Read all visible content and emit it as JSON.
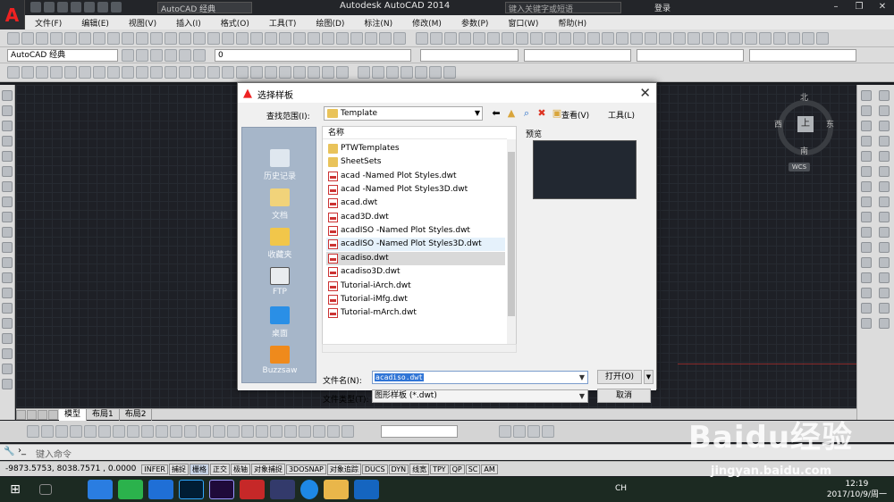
{
  "app": {
    "title": "Autodesk AutoCAD 2014",
    "workspace": "AutoCAD 经典",
    "search_placeholder": "键入关键字或短语",
    "login": "登录",
    "logo_letter": "A"
  },
  "menu": [
    "文件(F)",
    "编辑(E)",
    "视图(V)",
    "插入(I)",
    "格式(O)",
    "工具(T)",
    "绘图(D)",
    "标注(N)",
    "修改(M)",
    "参数(P)",
    "窗口(W)",
    "帮助(H)"
  ],
  "toolbar2": {
    "workspace": "AutoCAD 经典",
    "layer": "0"
  },
  "viewcube": {
    "top": "上",
    "north": "北",
    "south": "南",
    "east": "东",
    "west": "西",
    "wcs": "WCS"
  },
  "layout_tabs": [
    "模型",
    "布局1",
    "布局2"
  ],
  "command_line": {
    "placeholder": "键入命令"
  },
  "status": {
    "coords": "-9873.5753, 8038.7571 , 0.0000",
    "buttons": [
      {
        "label": "INFER",
        "on": false
      },
      {
        "label": "捕捉",
        "on": false
      },
      {
        "label": "栅格",
        "on": true
      },
      {
        "label": "正交",
        "on": false
      },
      {
        "label": "极轴",
        "on": false
      },
      {
        "label": "对象捕捉",
        "on": false
      },
      {
        "label": "3DOSNAP",
        "on": false
      },
      {
        "label": "对象追踪",
        "on": false
      },
      {
        "label": "DUCS",
        "on": false
      },
      {
        "label": "DYN",
        "on": false
      },
      {
        "label": "线宽",
        "on": false
      },
      {
        "label": "TPY",
        "on": false
      },
      {
        "label": "QP",
        "on": false
      },
      {
        "label": "SC",
        "on": false
      },
      {
        "label": "AM",
        "on": false
      }
    ]
  },
  "dialog": {
    "title": "选择样板",
    "look_in_label": "查找范围(I):",
    "look_in_value": "Template",
    "view_menu": "查看(V)",
    "tools_menu": "工具(L)",
    "places": [
      "历史记录",
      "文档",
      "收藏夹",
      "FTP",
      "桌面",
      "Buzzsaw"
    ],
    "column_header": "名称",
    "files": [
      {
        "name": "PTWTemplates",
        "type": "folder"
      },
      {
        "name": "SheetSets",
        "type": "folder"
      },
      {
        "name": "acad -Named Plot Styles.dwt",
        "type": "dwt"
      },
      {
        "name": "acad -Named Plot Styles3D.dwt",
        "type": "dwt"
      },
      {
        "name": "acad.dwt",
        "type": "dwt"
      },
      {
        "name": "acad3D.dwt",
        "type": "dwt"
      },
      {
        "name": "acadISO -Named Plot Styles.dwt",
        "type": "dwt"
      },
      {
        "name": "acadISO -Named Plot Styles3D.dwt",
        "type": "dwt"
      },
      {
        "name": "acadiso.dwt",
        "type": "dwt"
      },
      {
        "name": "acadiso3D.dwt",
        "type": "dwt"
      },
      {
        "name": "Tutorial-iArch.dwt",
        "type": "dwt"
      },
      {
        "name": "Tutorial-iMfg.dwt",
        "type": "dwt"
      },
      {
        "name": "Tutorial-mArch.dwt",
        "type": "dwt"
      }
    ],
    "selected_file": "acadiso.dwt",
    "hover_file": "acadISO -Named Plot Styles3D.dwt",
    "preview_label": "预览",
    "file_name_label": "文件名(N):",
    "file_name_value": "acadiso.dwt",
    "file_type_label": "文件类型(T):",
    "file_type_value": "图形样板 (*.dwt)",
    "open_button": "打开(O)",
    "cancel_button": "取消"
  },
  "taskbar": {
    "ime": "CH",
    "time": "12:19",
    "date": "2017/10/9/周一"
  },
  "watermark": {
    "logo": "Baidu经验",
    "url": "jingyan.baidu.com"
  },
  "colors": {
    "drawing_bg": "#1e2026",
    "accent": "#3075d6",
    "autocad_red": "#e22222",
    "places_bg": "#a6b6c9"
  }
}
